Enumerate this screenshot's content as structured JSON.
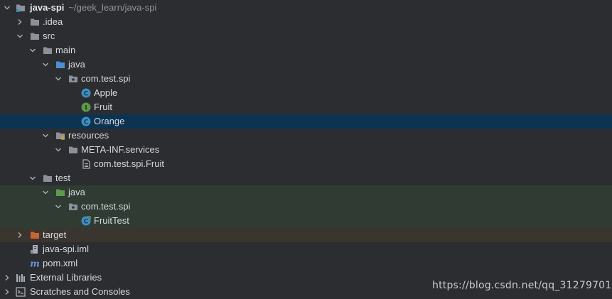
{
  "project": {
    "name": "java-spi",
    "path": "~/geek_learn/java-spi"
  },
  "tree": {
    "idea": ".idea",
    "src": "src",
    "main": "main",
    "main_java": "java",
    "main_package": "com.test.spi",
    "apple": "Apple",
    "fruit": "Fruit",
    "orange": "Orange",
    "resources": "resources",
    "meta_inf": "META-INF.services",
    "service_file": "com.test.spi.Fruit",
    "test": "test",
    "test_java": "java",
    "test_package": "com.test.spi",
    "fruit_test": "FruitTest",
    "target": "target",
    "iml": "java-spi.iml",
    "pom": "pom.xml",
    "external_libraries": "External Libraries",
    "scratches": "Scratches and Consoles"
  },
  "watermark": "https://blog.csdn.net/qq_31279701",
  "colors": {
    "background": "#2b2d30",
    "selected_row": "#0d3352",
    "test_rows": "#2f3b33",
    "excluded_row": "#3b3530",
    "folder": "#8c9099",
    "source_folder": "#4d8fd1",
    "test_folder": "#5b9c4e",
    "excluded_folder": "#c8662f",
    "class_icon": "#3d8fbf",
    "interface_icon": "#5c9a4a"
  }
}
